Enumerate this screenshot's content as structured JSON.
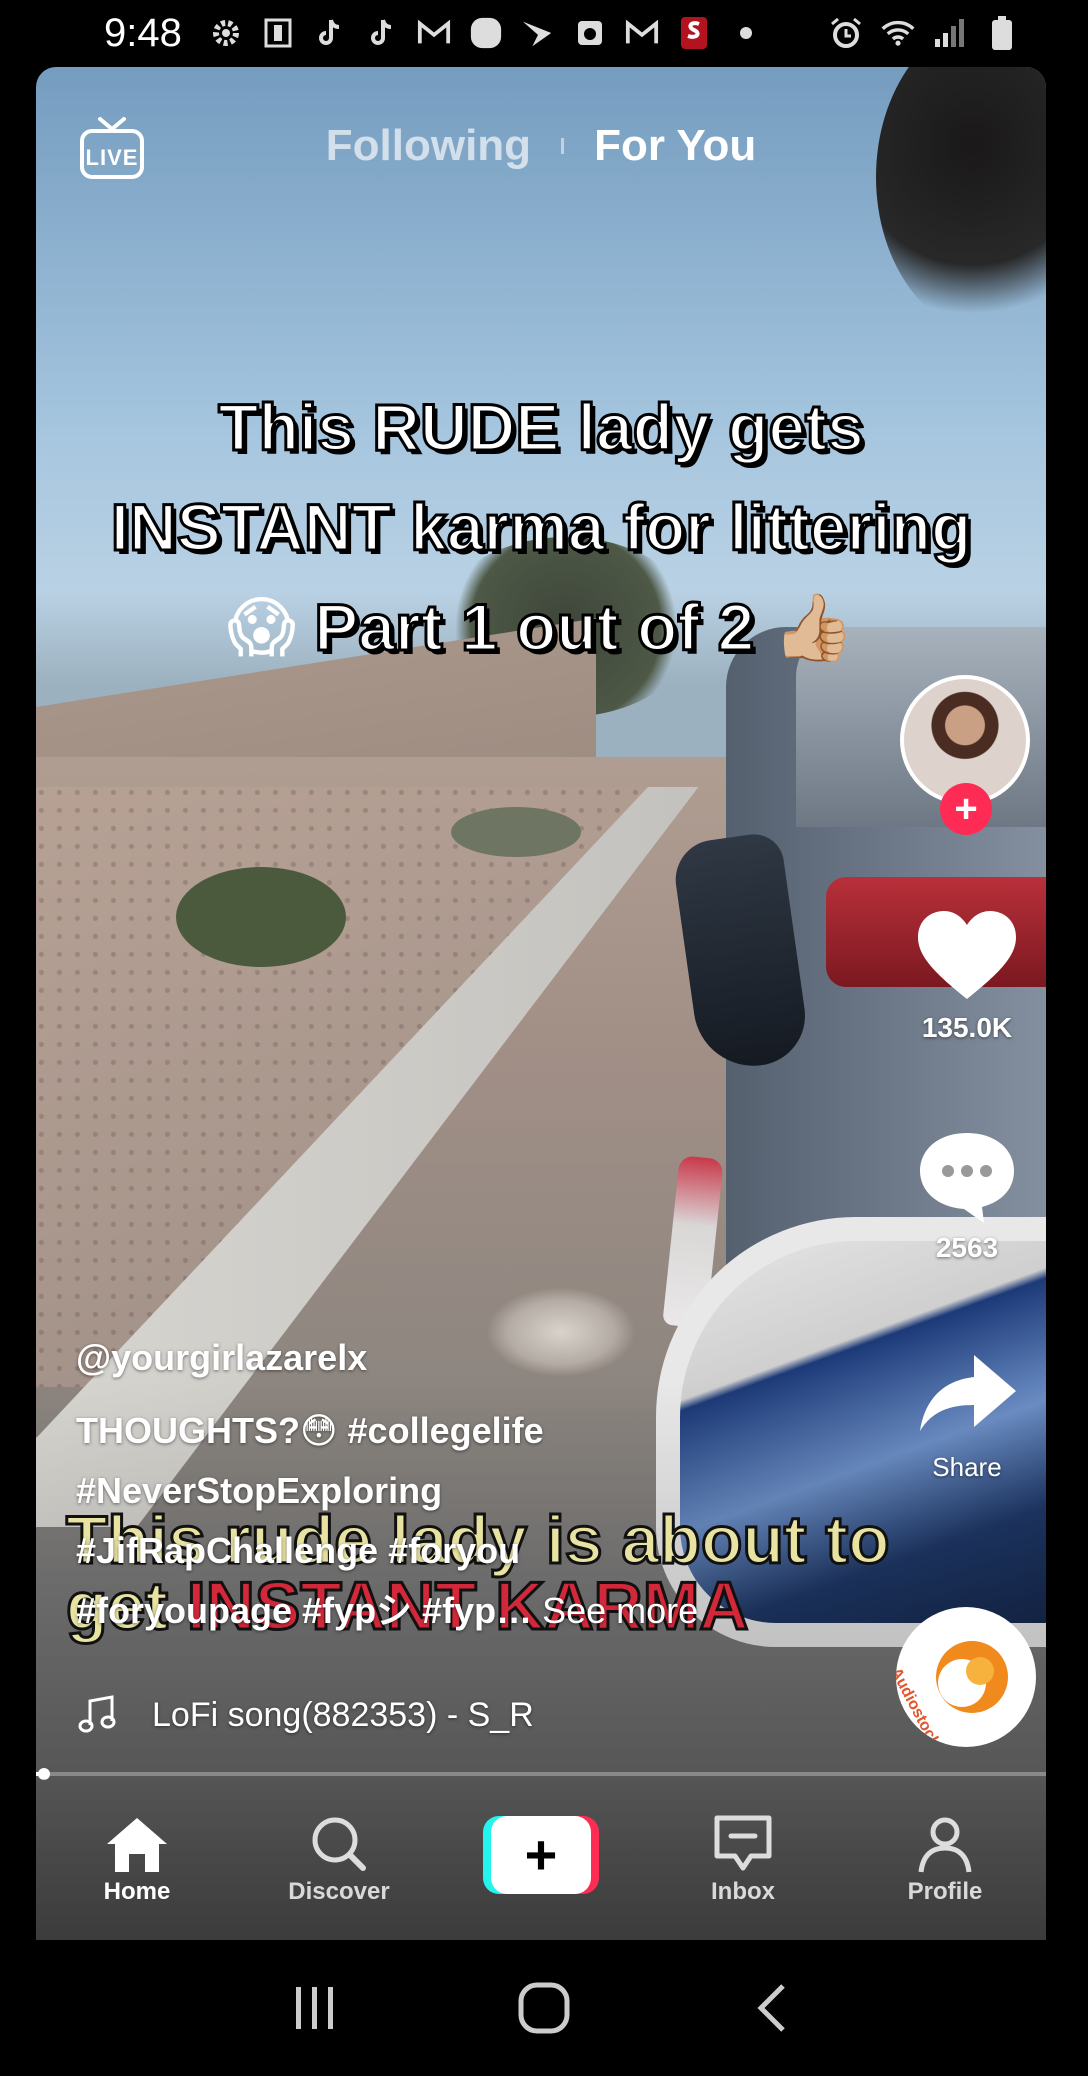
{
  "status_bar": {
    "time": "9:48",
    "left_icons": [
      "gear-icon",
      "news-icon",
      "tiktok-icon",
      "tiktok-icon",
      "gmail-icon",
      "circle-app-icon",
      "swipe-app-icon",
      "calendar-app-icon",
      "gmail-icon",
      "stanford-icon",
      "dot-icon"
    ],
    "right_icons": [
      "alarm-icon",
      "wifi-icon",
      "signal-icon",
      "battery-icon"
    ]
  },
  "top_nav": {
    "live_label": "LIVE",
    "following_label": "Following",
    "for_you_label": "For You"
  },
  "overlay_title": {
    "line1": "This RUDE lady gets",
    "line2": "INSTANT karma for littering",
    "line3_emoji_left": "😱",
    "line3_text": "Part 1 out of 2",
    "line3_emoji_right": "👍🏼"
  },
  "burned_caption": {
    "line1": "This rude lady is about to",
    "line2_prefix": "get ",
    "line2_red": "INSTANT KARMA"
  },
  "post": {
    "author": "@yourgirlazarelx",
    "desc_line1_text": "THOUGHTS?",
    "desc_line1_emoji": "😳",
    "desc_line1_tag": "#collegelife",
    "desc_line2": "#NeverStopExploring",
    "desc_line3": "#JifRapChallenge #foryou",
    "desc_line4": "#foryoupage #fypシ #fyp…",
    "see_more": "See more",
    "music": "LoFi song(882353) - S_R"
  },
  "right_rail": {
    "like_count": "135.0K",
    "comment_count": "2563",
    "share_label": "Share",
    "sound_disc_label": "Audiostock",
    "follow_plus": "+"
  },
  "progress": {
    "fraction": 0.01
  },
  "bottom_nav": {
    "home": "Home",
    "discover": "Discover",
    "create": "+",
    "inbox": "Inbox",
    "profile": "Profile"
  },
  "colors": {
    "accent_red": "#fe2c55",
    "accent_cyan": "#25f4ee",
    "burn_yellow": "#e8e3a1",
    "burn_red": "#d2283a"
  }
}
